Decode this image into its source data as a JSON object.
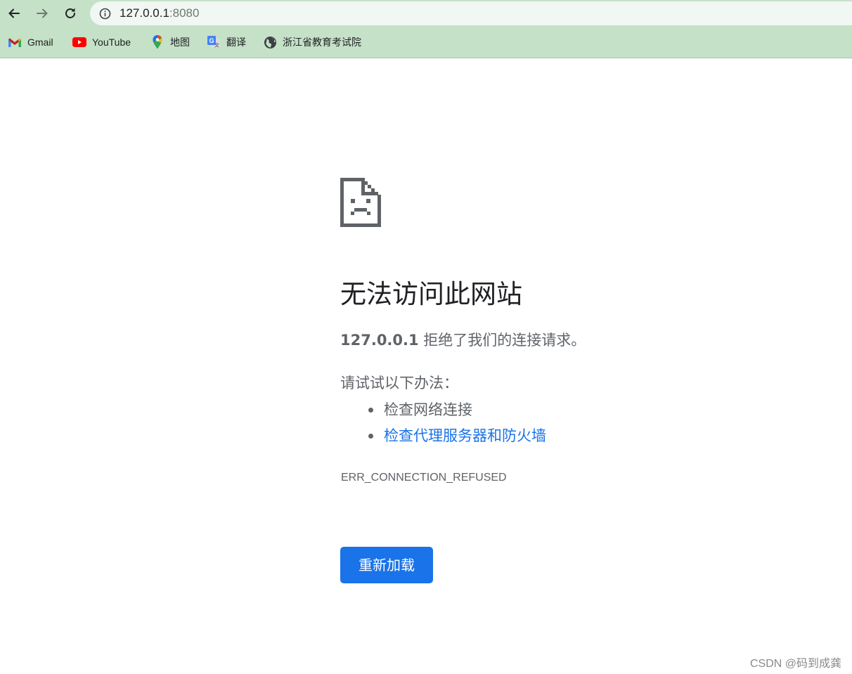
{
  "browser": {
    "url_host": "127.0.0.1",
    "url_port": ":8080",
    "icons": {
      "back": "arrow-left-icon",
      "forward": "arrow-right-icon",
      "reload": "reload-icon",
      "site_info": "info-icon"
    }
  },
  "bookmarks": [
    {
      "label": "Gmail",
      "icon": "gmail-icon"
    },
    {
      "label": "YouTube",
      "icon": "youtube-icon"
    },
    {
      "label": "地图",
      "icon": "maps-icon"
    },
    {
      "label": "翻译",
      "icon": "translate-icon"
    },
    {
      "label": "浙江省教育考试院",
      "icon": "globe-icon"
    }
  ],
  "error": {
    "icon": "sad-page-icon",
    "title": "无法访问此网站",
    "host": "127.0.0.1",
    "message": " 拒绝了我们的连接请求。",
    "suggest_heading": "请试试以下办法：",
    "suggestions": [
      {
        "label": "检查网络连接",
        "link": false
      },
      {
        "label": "检查代理服务器和防火墙",
        "link": true
      }
    ],
    "code": "ERR_CONNECTION_REFUSED",
    "reload_label": "重新加载"
  },
  "watermark": "CSDN @码到成龚",
  "colors": {
    "chrome_bg": "#c5e1c8",
    "link": "#1a73e8",
    "button": "#1a73e8",
    "text_secondary": "#5f6368"
  }
}
